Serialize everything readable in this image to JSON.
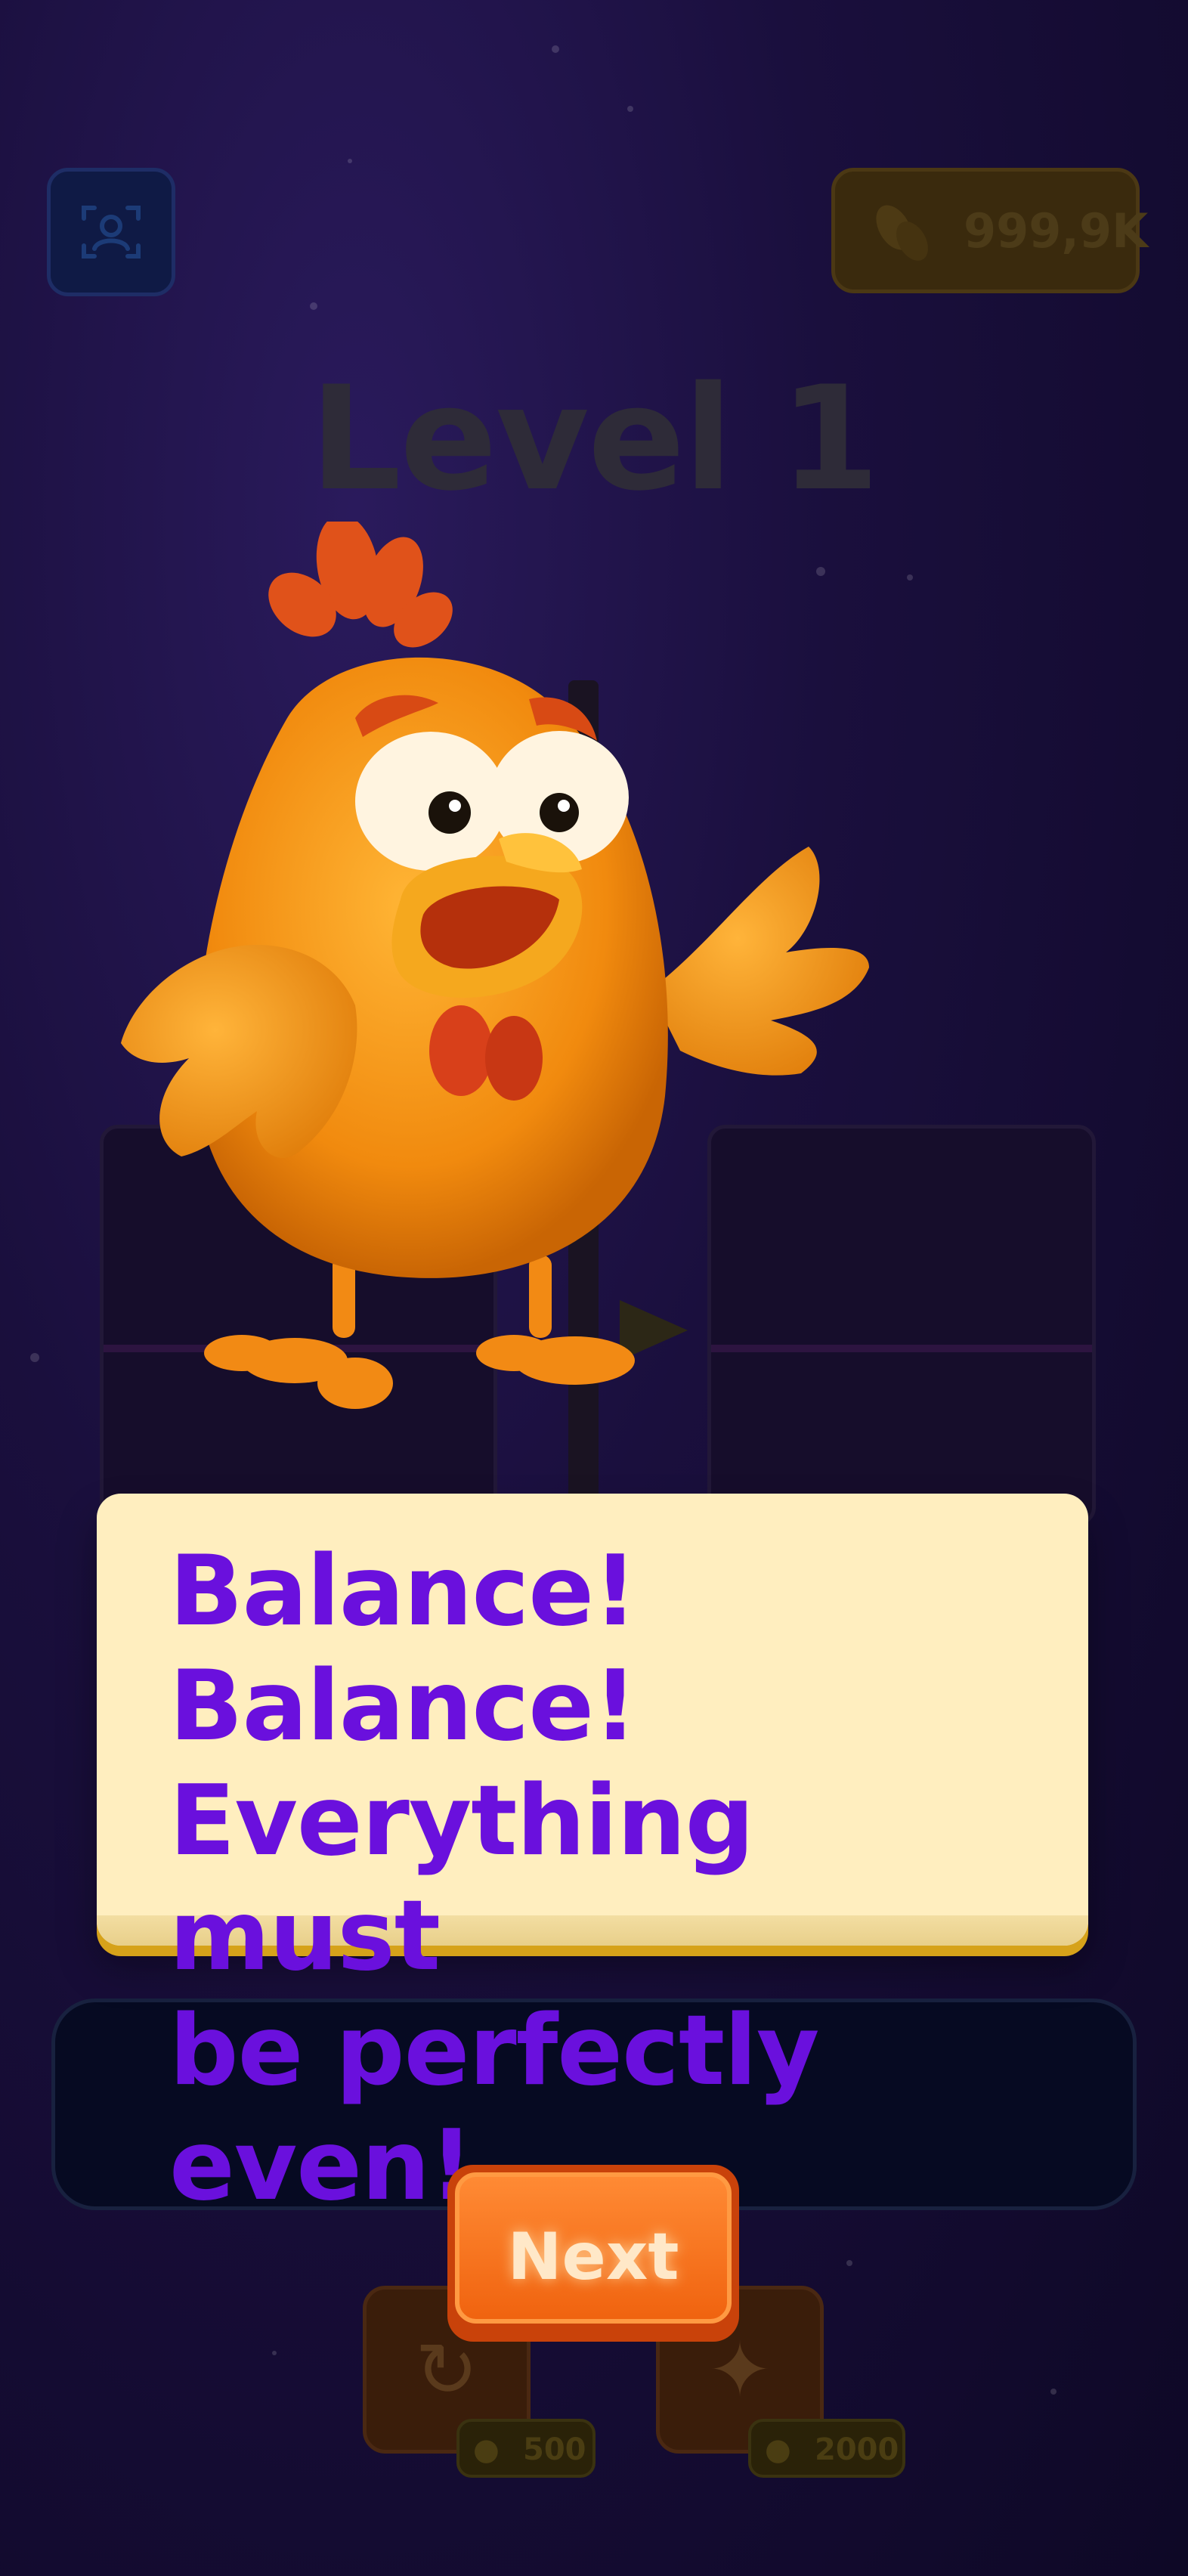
{
  "header": {
    "profile_icon": "profile-scan-icon",
    "coins_icon": "seeds-icon",
    "coins_value": "999,9K"
  },
  "level": {
    "title": "Level 1"
  },
  "dialog": {
    "lines": [
      "Balance! Balance!",
      "Everything must",
      "be perfectly even!"
    ]
  },
  "next_button": {
    "label": "Next"
  },
  "tools": [
    {
      "icon": "undo-icon",
      "cost": "500"
    },
    {
      "icon": "magic-wand-icon",
      "cost": "2000"
    }
  ],
  "colors": {
    "dialog_text": "#6a10dd",
    "dialog_bg": "#ffeebf",
    "next_button": "#f0630f"
  }
}
